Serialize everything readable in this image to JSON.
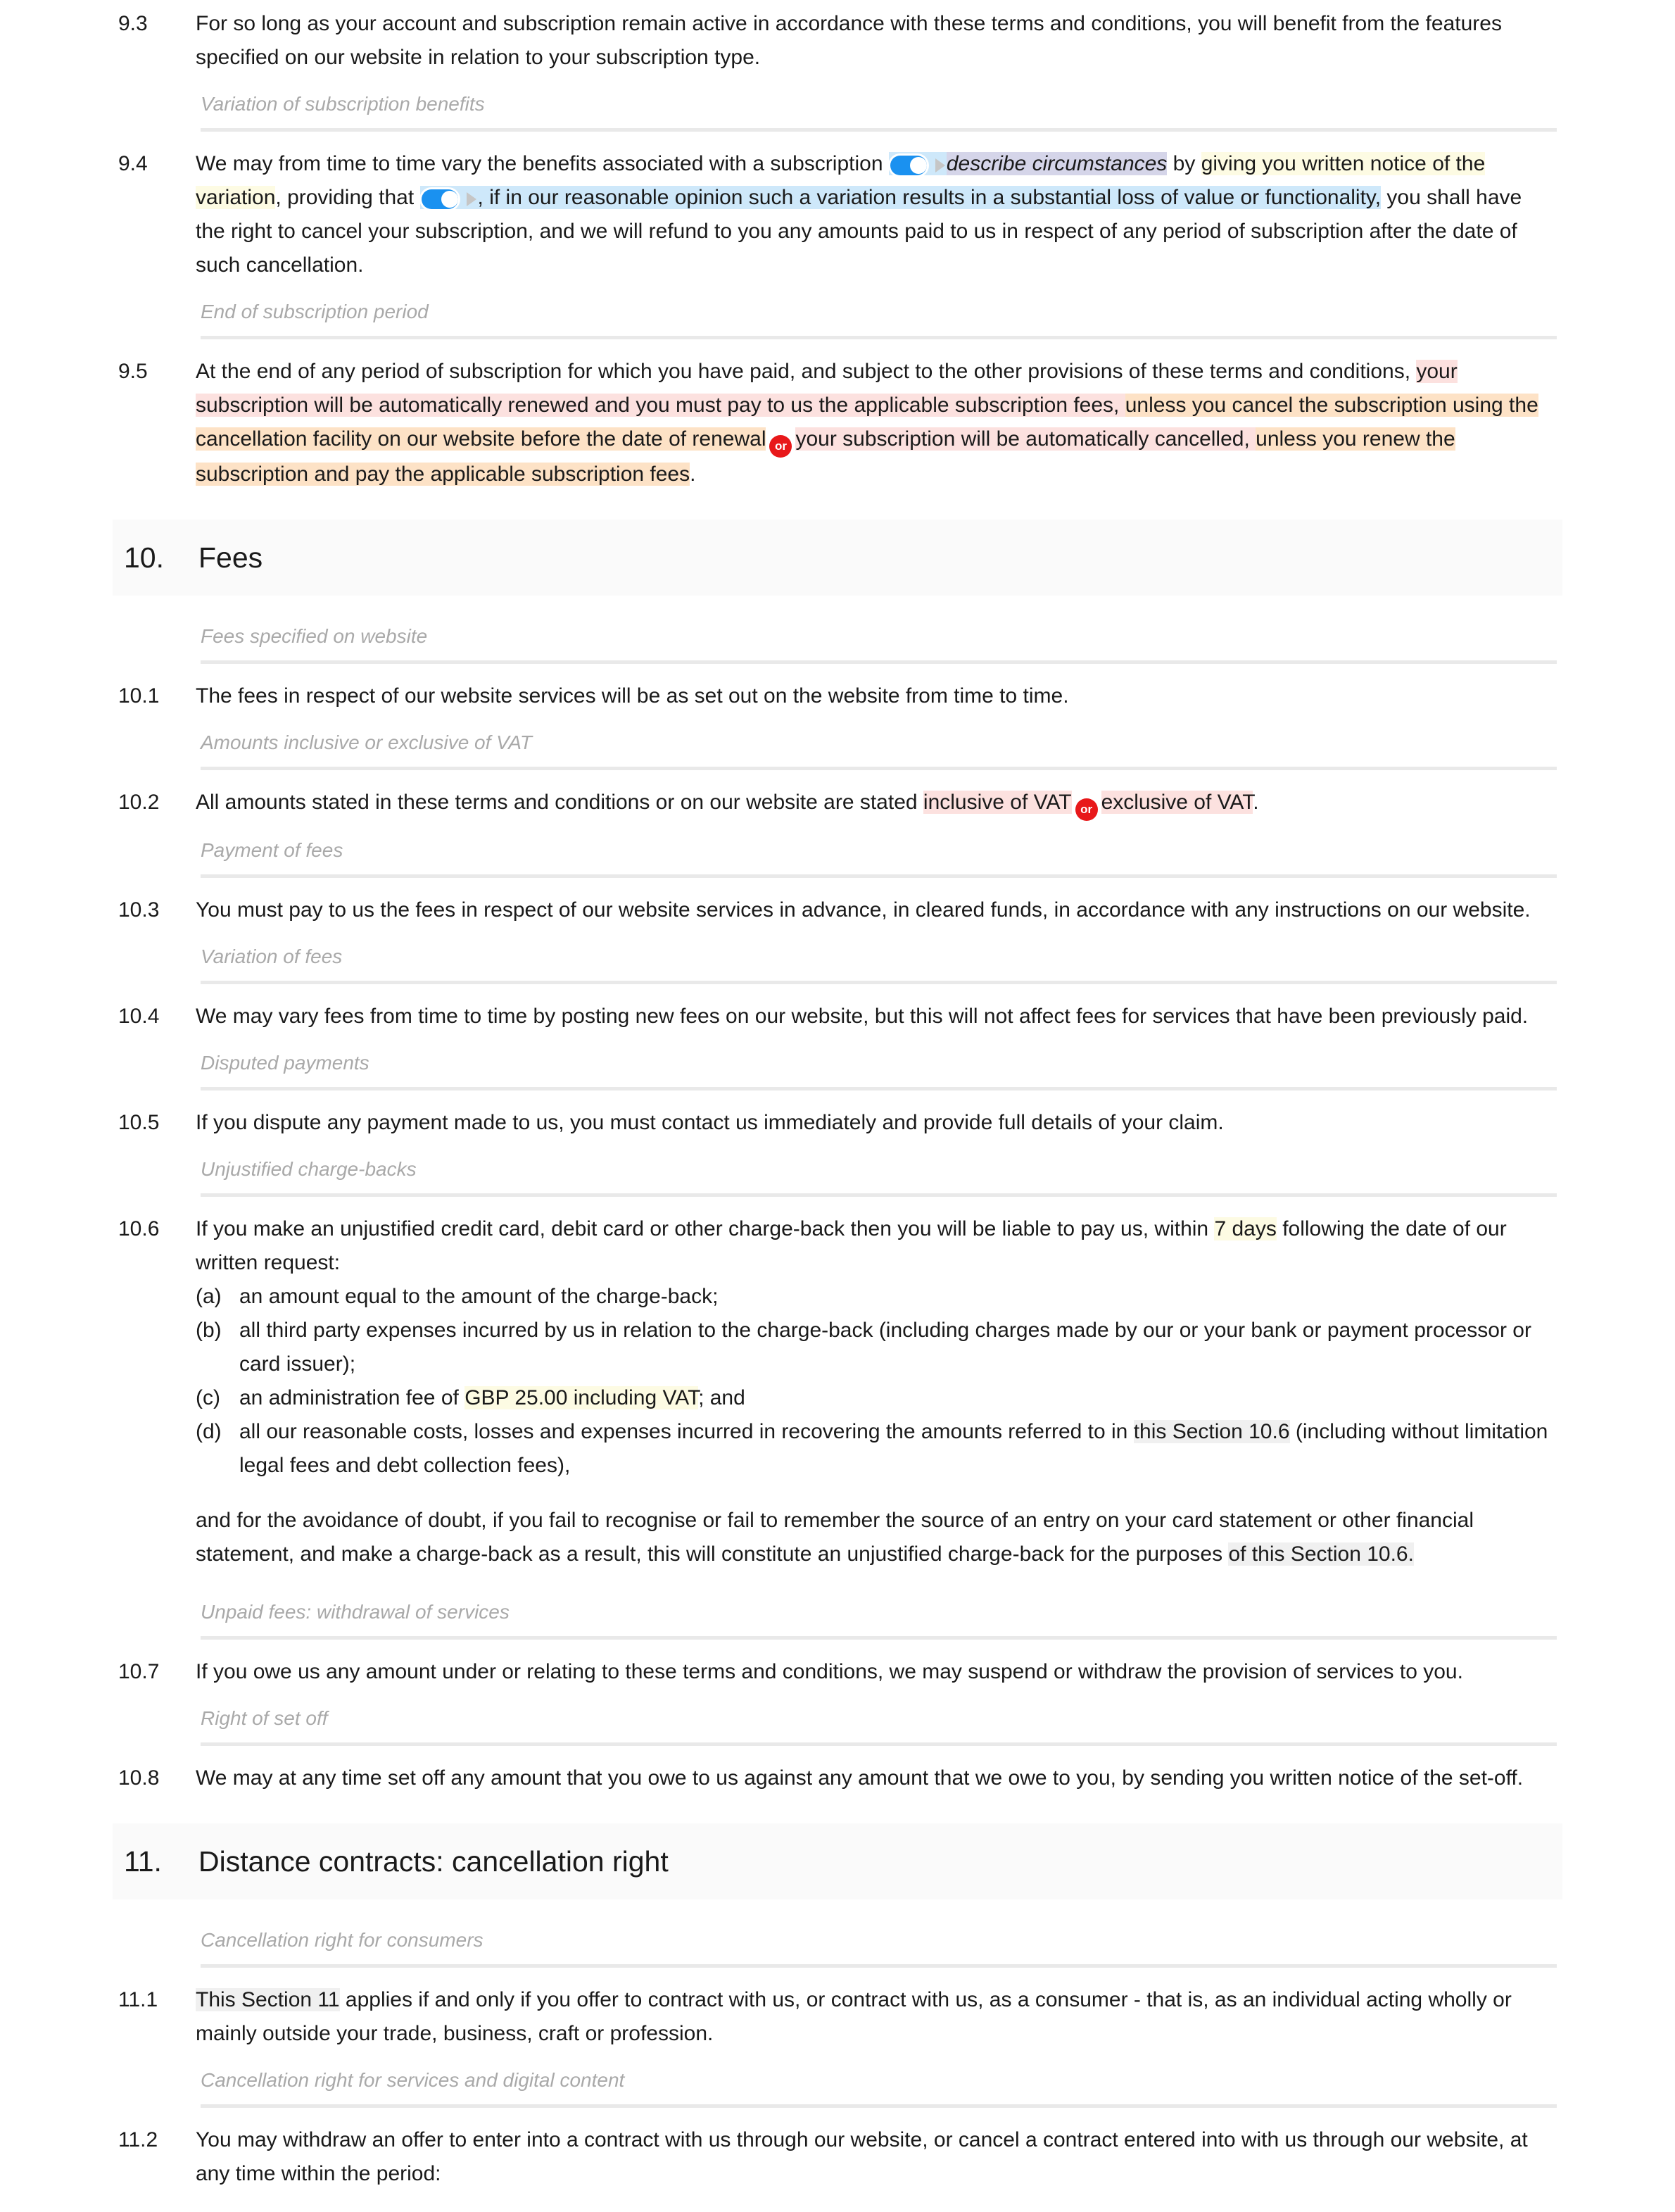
{
  "document": {
    "colors": {
      "highlight_yellow": "#fdfbe3",
      "highlight_blue": "#cee8fa",
      "highlight_lavender": "#d5d5e9",
      "highlight_pink": "#fce1df",
      "highlight_orange": "#fde2c6",
      "highlight_grey": "#f0f0f0",
      "toggle_on": "#1a91f0",
      "or_badge": "#e8181a",
      "section_band": "#fafafa",
      "rule": "#e9e9e9",
      "subheading_text": "#a9a9a9"
    }
  },
  "clauses": {
    "c93": {
      "num": "9.3",
      "text": "For so long as your account and subscription remain active in accordance with these terms and conditions, you will benefit from the features specified on our website in relation to your subscription type."
    },
    "c94": {
      "num": "9.4",
      "part1": "We may from time to time vary the benefits associated with a subscription",
      "toggle1_label": "describe circumstances",
      "part2": "by",
      "hl_written_notice": "giving you written notice of the variation",
      "part3": ", providing that",
      "hl_blue_run": ", if in our reasonable opinion such a variation results in a substantial loss of value or functionality,",
      "part4": "you shall have the right to cancel your subscription, and we will refund to you any amounts paid to us in respect of any period of subscription after the date of such cancellation."
    },
    "c95": {
      "num": "9.5",
      "lead": "At the end of any period of subscription for which you have paid, and subject to the other provisions of these terms and conditions,",
      "option_a_part1": "your subscription will be automatically renewed and you must pay to us the applicable subscription fees,",
      "option_a_part2": "unless you cancel the subscription using the cancellation facility on our website before the date of renewal",
      "or_badge": "or",
      "option_b_part1": "your subscription will be automatically cancelled,",
      "option_b_part2": "unless you renew the subscription and pay the applicable subscription fees",
      "tail": "."
    },
    "c101": {
      "num": "10.1",
      "text": "The fees in respect of our website services will be as set out on the website from time to time."
    },
    "c102": {
      "num": "10.2",
      "lead": "All amounts stated in these terms and conditions or on our website are stated",
      "option_a": "inclusive of VAT",
      "or_badge": "or",
      "option_b": "exclusive of VAT",
      "tail": "."
    },
    "c103": {
      "num": "10.3",
      "text": "You must pay to us the fees in respect of our website services in advance, in cleared funds, in accordance with any instructions on our website."
    },
    "c104": {
      "num": "10.4",
      "text": "We may vary fees from time to time by posting new fees on our website, but this will not affect fees for services that have been previously paid."
    },
    "c105": {
      "num": "10.5",
      "text": "If you dispute any payment made to us, you must contact us immediately and provide full details of your claim."
    },
    "c106": {
      "num": "10.6",
      "lead_part1": "If you make an unjustified credit card, debit card or other charge-back then you will be liable to pay us, within",
      "hl_days": "7 days",
      "lead_part2": "following the date of our written request:",
      "items": [
        {
          "label": "(a)",
          "text": "an amount equal to the amount of the charge-back;"
        },
        {
          "label": "(b)",
          "text": "all third party expenses incurred by us in relation to the charge-back (including charges made by our or your bank or payment processor or card issuer);"
        },
        {
          "label": "(c)",
          "pre": "an administration fee of",
          "hl": "GBP 25.00 including VAT",
          "post": "; and"
        },
        {
          "label": "(d)",
          "pre": "all our reasonable costs, losses and expenses incurred in recovering the amounts referred to in",
          "hl": "this Section 10.6",
          "post": " (including without limitation legal fees and debt collection fees),"
        }
      ],
      "tail_pre": "and for the avoidance of doubt, if you fail to recognise or fail to remember the source of an entry on your card statement or other financial statement, and make a charge-back as a result, this will constitute an unjustified charge-back for the purposes",
      "tail_hl": "of this Section 10.6.",
      "tail_post": ""
    },
    "c107": {
      "num": "10.7",
      "text": "If you owe us any amount under or relating to these terms and conditions, we may suspend or withdraw the provision of services to you."
    },
    "c108": {
      "num": "10.8",
      "text": "We may at any time set off any amount that you owe to us against any amount that we owe to you, by sending you written notice of the set-off."
    },
    "c111": {
      "num": "11.1",
      "hl": "This Section 11",
      "text": " applies if and only if you offer to contract with us, or contract with us, as a consumer - that is, as an individual acting wholly or mainly outside your trade, business, craft or profession."
    },
    "c112": {
      "num": "11.2",
      "text": "You may withdraw an offer to enter into a contract with us through our website, or cancel a contract entered into with us through our website, at any time within the period:"
    }
  },
  "subheadings": {
    "variation_of_subscription_benefits": "Variation of subscription benefits",
    "end_of_subscription_period": "End of subscription period",
    "fees_specified_on_website": "Fees specified on website",
    "amounts_inclusive_or_exclusive_of_vat": "Amounts inclusive or exclusive of VAT",
    "payment_of_fees": "Payment of fees",
    "variation_of_fees": "Variation of fees",
    "disputed_payments": "Disputed payments",
    "unjustified_charge_backs": "Unjustified charge-backs",
    "unpaid_fees_withdrawal_of_services": "Unpaid fees: withdrawal of services",
    "right_of_set_off": "Right of set off",
    "cancellation_right_for_consumers": "Cancellation right for consumers",
    "cancellation_right_for_services_and_digital_content": "Cancellation right for services and digital content"
  },
  "sections": {
    "s10": {
      "num": "10.",
      "title": "Fees"
    },
    "s11": {
      "num": "11.",
      "title": "Distance contracts: cancellation right"
    }
  }
}
